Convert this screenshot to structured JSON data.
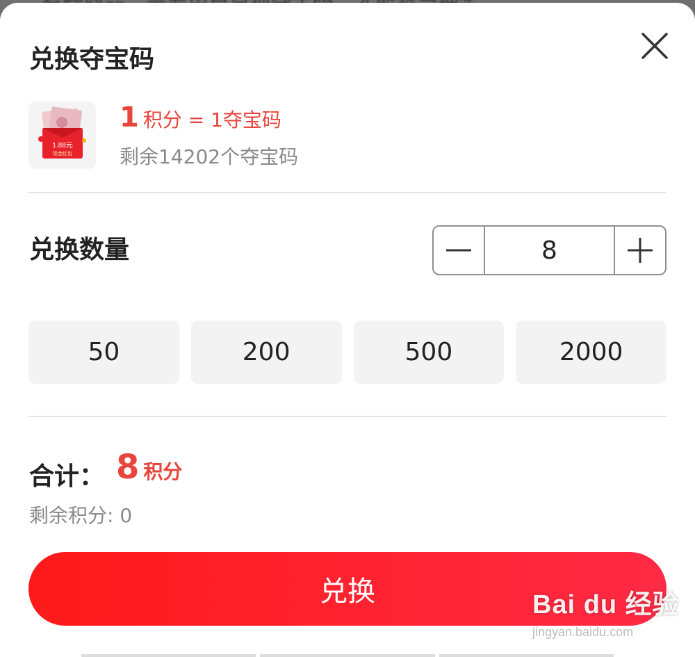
{
  "backdrop_text": "有些商品，需要用户兑换夺宝码，才能参与抽奖。",
  "dialog": {
    "title": "兑换夺宝码",
    "close_icon": "close-icon"
  },
  "product": {
    "thumb_icon": "red-envelope-icon",
    "thumb_amount": "1.88元",
    "thumb_caption": "现金红包",
    "rate_qty": "1",
    "rate_text": "积分 = 1夺宝码",
    "remaining_codes": "剩余14202个夺宝码"
  },
  "quantity": {
    "label": "兑换数量",
    "value": "8",
    "minus_icon": "minus-icon",
    "plus_icon": "plus-icon"
  },
  "presets": [
    "50",
    "200",
    "500",
    "2000"
  ],
  "total": {
    "label": "合计：",
    "value": "8",
    "unit": "积分",
    "remaining_points": "剩余积分: 0"
  },
  "submit_label": "兑换",
  "watermark": {
    "brand": "Bai du 经验",
    "url": "jingyan.baidu.com"
  },
  "colors": {
    "accent": "#e8453c",
    "button_start": "#ff1a1a",
    "button_end": "#ff2a45"
  }
}
